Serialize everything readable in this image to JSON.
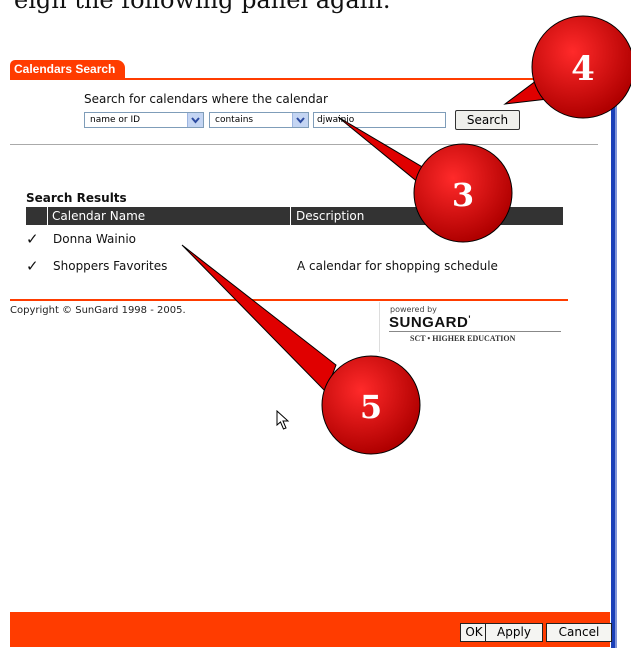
{
  "top_text": "eign the following panel again.",
  "tab": {
    "label": "Calendars Search"
  },
  "search": {
    "prompt": "Search for calendars where the calendar",
    "field_select": "name or ID",
    "operator_select": "contains",
    "query_value": "djwainio",
    "search_button": "Search"
  },
  "results": {
    "title": "Search Results",
    "columns": [
      "Calendar Name",
      "Description"
    ],
    "rows": [
      {
        "name": "Donna Wainio",
        "description": ""
      },
      {
        "name": "Shoppers Favorites",
        "description": "A calendar for shopping schedule"
      }
    ]
  },
  "footer": {
    "copyright": "Copyright © SunGard 1998 - 2005.",
    "powered_by": "powered by",
    "brand": "SUNGARD",
    "brand_sub": "SCT • HIGHER EDUCATION"
  },
  "callouts": [
    {
      "label": "4"
    },
    {
      "label": "3"
    },
    {
      "label": "5"
    }
  ],
  "dialog_buttons": {
    "ok": "OK",
    "apply": "Apply",
    "cancel": "Cancel"
  },
  "colors": {
    "accent": "#ff3c00",
    "callout_fill": "#e00000",
    "header_dark": "#333333",
    "side_bar": "#1a3fb8"
  },
  "icons": [
    "chevron-down-icon",
    "checkmark-icon",
    "mouse-pointer-icon"
  ]
}
